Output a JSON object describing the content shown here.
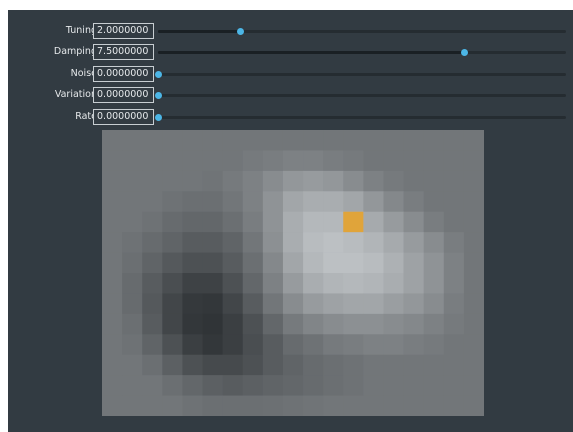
{
  "colors": {
    "panel_bg": "#323b42",
    "accent": "#4cb6e6",
    "marker": "#e0a43a"
  },
  "controls": [
    {
      "label": "Tuning",
      "value": "2.0000000",
      "level": 0.2
    },
    {
      "label": "Damping",
      "value": "7.5000000",
      "level": 0.75
    },
    {
      "label": "Noise",
      "value": "0.0000000",
      "level": 0.0
    },
    {
      "label": "Variation",
      "value": "0.0000000",
      "level": 0.0
    },
    {
      "label": "Rate",
      "value": "0.0000000",
      "level": 0.0
    }
  ],
  "heatmap": {
    "cols": 19,
    "rows": 14,
    "values": [
      [
        0.5,
        0.5,
        0.5,
        0.5,
        0.5,
        0.5,
        0.5,
        0.5,
        0.5,
        0.5,
        0.5,
        0.5,
        0.5,
        0.5,
        0.5,
        0.5,
        0.5,
        0.5,
        0.5
      ],
      [
        0.5,
        0.5,
        0.5,
        0.5,
        0.5,
        0.5,
        0.5,
        0.52,
        0.54,
        0.56,
        0.56,
        0.54,
        0.52,
        0.5,
        0.5,
        0.5,
        0.5,
        0.5,
        0.5
      ],
      [
        0.5,
        0.5,
        0.5,
        0.5,
        0.5,
        0.49,
        0.52,
        0.56,
        0.62,
        0.68,
        0.7,
        0.68,
        0.62,
        0.56,
        0.52,
        0.5,
        0.5,
        0.5,
        0.5
      ],
      [
        0.5,
        0.5,
        0.5,
        0.48,
        0.46,
        0.46,
        0.5,
        0.56,
        0.66,
        0.76,
        0.8,
        0.8,
        0.76,
        0.68,
        0.6,
        0.54,
        0.5,
        0.5,
        0.5
      ],
      [
        0.5,
        0.5,
        0.48,
        0.44,
        0.42,
        0.42,
        0.46,
        0.54,
        0.66,
        0.8,
        0.86,
        0.86,
        0.84,
        0.78,
        0.7,
        0.62,
        0.54,
        0.5,
        0.5
      ],
      [
        0.5,
        0.48,
        0.44,
        0.4,
        0.36,
        0.36,
        0.4,
        0.5,
        0.64,
        0.8,
        0.88,
        0.9,
        0.88,
        0.84,
        0.78,
        0.7,
        0.62,
        0.54,
        0.5
      ],
      [
        0.5,
        0.46,
        0.4,
        0.34,
        0.3,
        0.3,
        0.36,
        0.46,
        0.6,
        0.76,
        0.86,
        0.9,
        0.9,
        0.88,
        0.82,
        0.74,
        0.66,
        0.56,
        0.5
      ],
      [
        0.5,
        0.44,
        0.36,
        0.28,
        0.22,
        0.22,
        0.3,
        0.42,
        0.56,
        0.7,
        0.8,
        0.84,
        0.86,
        0.84,
        0.8,
        0.74,
        0.66,
        0.56,
        0.5
      ],
      [
        0.5,
        0.44,
        0.34,
        0.24,
        0.17,
        0.16,
        0.24,
        0.36,
        0.5,
        0.62,
        0.7,
        0.74,
        0.76,
        0.76,
        0.72,
        0.68,
        0.62,
        0.54,
        0.5
      ],
      [
        0.5,
        0.46,
        0.36,
        0.24,
        0.16,
        0.14,
        0.2,
        0.3,
        0.42,
        0.52,
        0.58,
        0.62,
        0.64,
        0.64,
        0.62,
        0.6,
        0.56,
        0.52,
        0.5
      ],
      [
        0.5,
        0.48,
        0.4,
        0.3,
        0.2,
        0.16,
        0.2,
        0.28,
        0.36,
        0.44,
        0.48,
        0.52,
        0.54,
        0.56,
        0.56,
        0.54,
        0.52,
        0.5,
        0.5
      ],
      [
        0.5,
        0.5,
        0.46,
        0.38,
        0.3,
        0.26,
        0.26,
        0.3,
        0.36,
        0.4,
        0.44,
        0.46,
        0.48,
        0.5,
        0.5,
        0.5,
        0.5,
        0.5,
        0.5
      ],
      [
        0.5,
        0.5,
        0.5,
        0.46,
        0.42,
        0.38,
        0.36,
        0.38,
        0.4,
        0.42,
        0.44,
        0.46,
        0.48,
        0.5,
        0.5,
        0.5,
        0.5,
        0.5,
        0.5
      ],
      [
        0.5,
        0.5,
        0.5,
        0.5,
        0.48,
        0.46,
        0.46,
        0.46,
        0.47,
        0.48,
        0.49,
        0.5,
        0.5,
        0.5,
        0.5,
        0.5,
        0.5,
        0.5,
        0.5
      ]
    ],
    "marker": {
      "col": 12,
      "row": 4
    }
  }
}
